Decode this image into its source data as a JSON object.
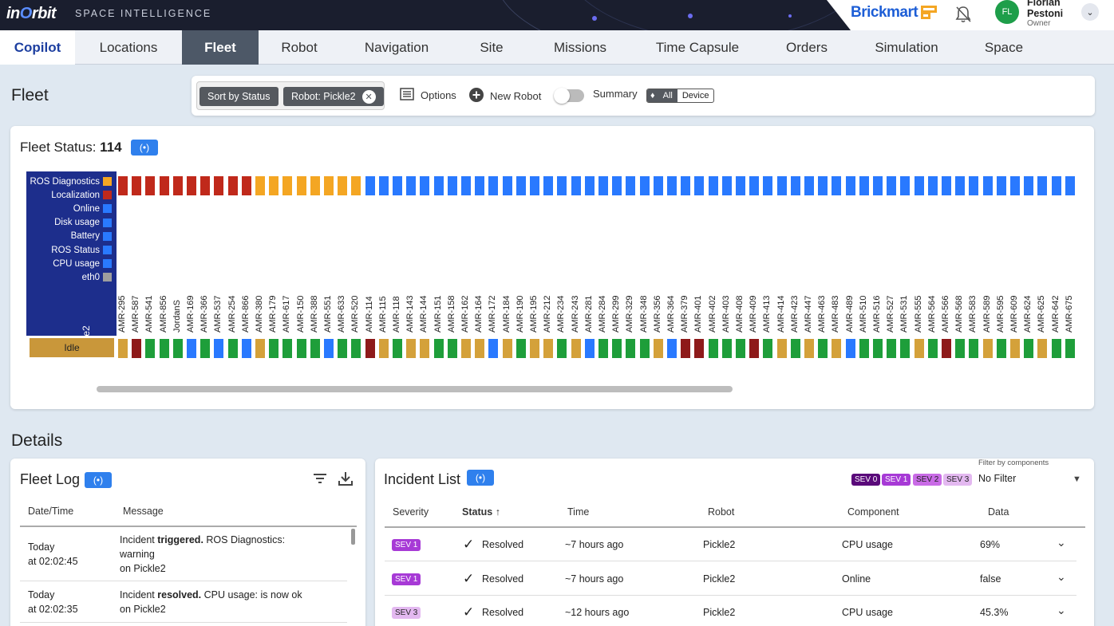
{
  "header": {
    "logo_prefix": "in",
    "logo_o": "O",
    "logo_suffix": "rbit",
    "tagline": "SPACE INTELLIGENCE",
    "brand": "Brickmart",
    "user_initials": "FL",
    "user_first": "Florian",
    "user_last": "Pestoni",
    "user_role": "Owner"
  },
  "nav": {
    "tabs": [
      "Copilot",
      "Locations",
      "Fleet",
      "Robot",
      "Navigation",
      "Site",
      "Missions",
      "Time Capsule",
      "Orders",
      "Simulation",
      "Space"
    ],
    "active": "Fleet"
  },
  "page": {
    "title": "Fleet"
  },
  "toolbar": {
    "sort_chip": "Sort by Status",
    "robot_chip": "Robot: Pickle2",
    "options": "Options",
    "new_robot": "New Robot",
    "summary": "Summary",
    "seg_all": "All",
    "seg_device": "Device"
  },
  "fleet_status": {
    "label": "Fleet Status:",
    "count": "114",
    "legend": [
      {
        "label": "ROS Diagnostics",
        "color": "#f4a623"
      },
      {
        "label": "Localization",
        "color": "#c0291b"
      },
      {
        "label": "Online",
        "color": "#2979ff"
      },
      {
        "label": "Disk usage",
        "color": "#2979ff"
      },
      {
        "label": "Battery",
        "color": "#2979ff"
      },
      {
        "label": "ROS Status",
        "color": "#2979ff"
      },
      {
        "label": "CPU usage",
        "color": "#2979ff"
      },
      {
        "label": "eth0",
        "color": "#9e9e9e"
      }
    ],
    "robot": "Pickle2",
    "robot_state": "Idle",
    "robots": [
      "AMR-295",
      "AMR-587",
      "AMR-541",
      "AMR-856",
      "JordanS",
      "AMR-169",
      "AMR-366",
      "AMR-537",
      "AMR-254",
      "AMR-866",
      "AMR-380",
      "AMR-179",
      "AMR-617",
      "AMR-150",
      "AMR-388",
      "AMR-551",
      "AMR-633",
      "AMR-520",
      "AMR-114",
      "AMR-115",
      "AMR-118",
      "AMR-143",
      "AMR-144",
      "AMR-151",
      "AMR-158",
      "AMR-162",
      "AMR-164",
      "AMR-172",
      "AMR-184",
      "AMR-190",
      "AMR-195",
      "AMR-212",
      "AMR-234",
      "AMR-243",
      "AMR-281",
      "AMR-284",
      "AMR-299",
      "AMR-329",
      "AMR-348",
      "AMR-356",
      "AMR-364",
      "AMR-379",
      "AMR-401",
      "AMR-402",
      "AMR-403",
      "AMR-408",
      "AMR-409",
      "AMR-413",
      "AMR-414",
      "AMR-423",
      "AMR-447",
      "AMR-463",
      "AMR-483",
      "AMR-489",
      "AMR-510",
      "AMR-516",
      "AMR-527",
      "AMR-531",
      "AMR-555",
      "AMR-564",
      "AMR-566",
      "AMR-568",
      "AMR-583",
      "AMR-589",
      "AMR-595",
      "AMR-609",
      "AMR-624",
      "AMR-625",
      "AMR-642",
      "AMR-675"
    ],
    "status_colors": {
      "orange": "#f4a623",
      "red": "#c0291b",
      "blue": "#2979ff",
      "gold": "#d4a13a",
      "green": "#1e9e3a",
      "darkred": "#8e1a1a"
    }
  },
  "details": {
    "title": "Details"
  },
  "fleet_log": {
    "title": "Fleet Log",
    "col_date": "Date/Time",
    "col_message": "Message",
    "rows": [
      {
        "day": "Today",
        "time": "at 02:02:45",
        "pre": "Incident ",
        "bold": "triggered.",
        "post": " ROS Diagnostics:",
        "line2": "warning",
        "line3": "on Pickle2"
      },
      {
        "day": "Today",
        "time": "at 02:02:35",
        "pre": "Incident ",
        "bold": "resolved.",
        "post": " CPU usage: is now ok",
        "line2": "on Pickle2",
        "line3": ""
      }
    ]
  },
  "incidents": {
    "title": "Incident List",
    "sev_filters": [
      "SEV 0",
      "SEV 1",
      "SEV 2",
      "SEV 3"
    ],
    "filter_label": "Filter by components",
    "filter_value": "No Filter",
    "cols": [
      "Severity",
      "Status",
      "Time",
      "Robot",
      "Component",
      "Data"
    ],
    "rows": [
      {
        "sev": "SEV 1",
        "status": "Resolved",
        "time": "~7 hours ago",
        "robot": "Pickle2",
        "component": "CPU usage",
        "data": "69%"
      },
      {
        "sev": "SEV 1",
        "status": "Resolved",
        "time": "~7 hours ago",
        "robot": "Pickle2",
        "component": "Online",
        "data": "false"
      },
      {
        "sev": "SEV 3",
        "status": "Resolved",
        "time": "~12 hours ago",
        "robot": "Pickle2",
        "component": "CPU usage",
        "data": "45.3%"
      }
    ]
  }
}
